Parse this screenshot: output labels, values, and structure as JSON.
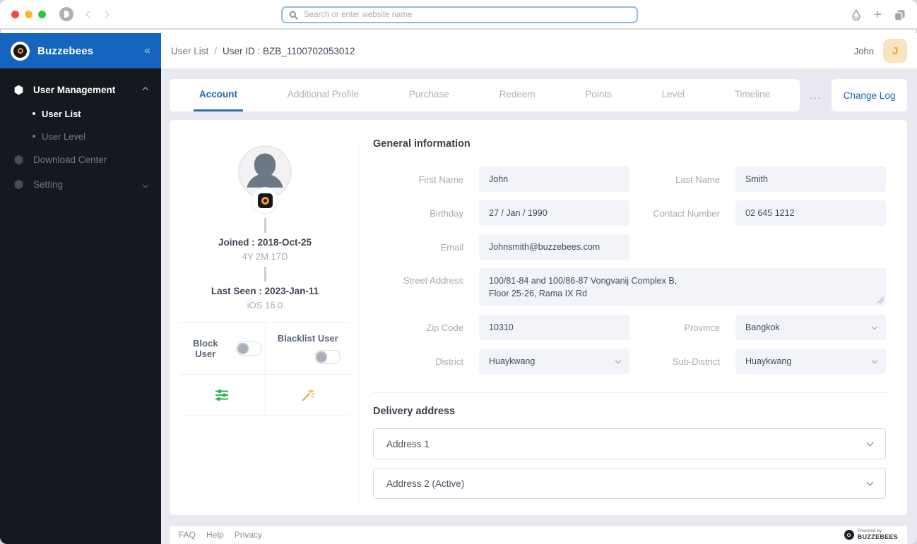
{
  "browser": {
    "search_placeholder": "Search or enter website name",
    "new_tab_glyph": "+"
  },
  "sidebar": {
    "brand": "Buzzebees",
    "collapse_glyph": "«",
    "items": [
      {
        "label": "User Management",
        "active": true,
        "expanded": true,
        "children": [
          {
            "label": "User List",
            "active": true
          },
          {
            "label": "User Level",
            "active": false
          }
        ]
      },
      {
        "label": "Download Center",
        "active": false
      },
      {
        "label": "Setting",
        "active": false,
        "expanded": false
      }
    ]
  },
  "header": {
    "breadcrumb": {
      "parent": "User List",
      "separator": "/",
      "current": "User ID : BZB_1100702053012"
    },
    "user_name": "John",
    "avatar_initial": "J"
  },
  "tabs": {
    "items": [
      "Account",
      "Additional Profile",
      "Purchase",
      "Redeem",
      "Points",
      "Level",
      "Timeline"
    ],
    "active": "Account",
    "more": "...",
    "change_log": "Change Log"
  },
  "profile": {
    "joined": "Joined : 2018-Oct-25",
    "joined_duration": "4Y 2M 17D",
    "last_seen": "Last Seen : 2023-Jan-11",
    "device": "iOS 16.0",
    "block_user_label": "Block User",
    "blacklist_user_label": "Blacklist User",
    "block_user_on": false,
    "blacklist_user_on": false
  },
  "general_info": {
    "title": "General information",
    "fields": {
      "first_name": {
        "label": "First Name",
        "value": "John"
      },
      "last_name": {
        "label": "Last Name",
        "value": "Smith"
      },
      "birthday": {
        "label": "Birthday",
        "value": "27 / Jan / 1990"
      },
      "contact_number": {
        "label": "Contact Number",
        "value": "02 645 1212"
      },
      "email": {
        "label": "Email",
        "value": "Johnsmith@buzzebees.com"
      },
      "street_address": {
        "label": "Street Address",
        "value": "100/81-84 and 100/86-87 Vongvanij Complex B,\nFloor 25-26, Rama IX Rd"
      },
      "zip_code": {
        "label": "Zip Code",
        "value": "10310"
      },
      "province": {
        "label": "Province",
        "value": "Bangkok"
      },
      "district": {
        "label": "District",
        "value": "Huaykwang"
      },
      "sub_district": {
        "label": "Sub-District",
        "value": "Huaykwang"
      }
    }
  },
  "delivery": {
    "title": "Delivery address",
    "addresses": [
      {
        "label": "Address 1"
      },
      {
        "label": "Address 2 (Active)"
      }
    ]
  },
  "footer": {
    "links": [
      "FAQ",
      "Help",
      "Privacy"
    ],
    "powered_by": "Powered by",
    "brand": "BUZZEBEES"
  },
  "icons": {
    "search": "magnifier",
    "collapse_sidebar": "double-chevron-left",
    "filter_action": "green-sliders",
    "grant_action": "orange-magic-wand",
    "browser_right": [
      "water-drop",
      "new-tab-plus",
      "tab-switcher"
    ]
  },
  "colors": {
    "accent_blue": "#1a66b8",
    "header_blue": "#1565be",
    "brand_orange": "#f09a2f",
    "success_green": "#2cb654",
    "sidebar_dark": "#15181e",
    "content_bg": "#e9eaf1",
    "input_bg": "#f2f4f9"
  }
}
